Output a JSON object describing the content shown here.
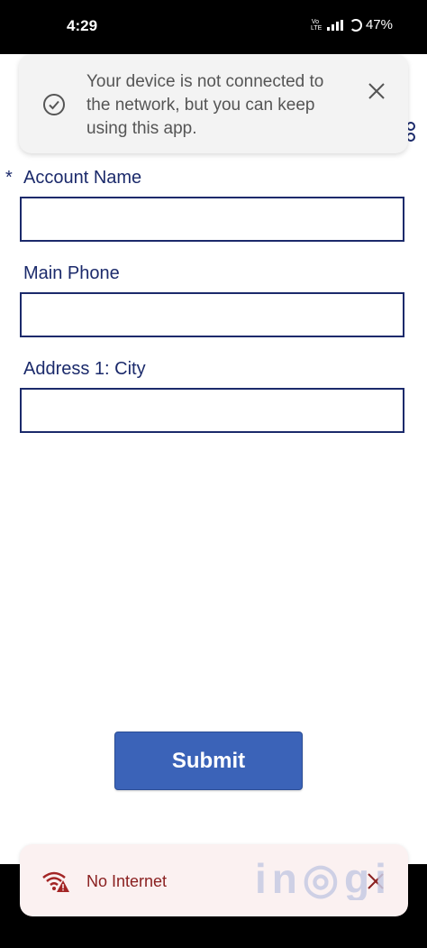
{
  "status_bar": {
    "time": "4:29",
    "network_label": "Vo LTE",
    "battery": "47%"
  },
  "toast": {
    "message": "Your device is not connected to the network, but you can keep using this app.",
    "icon": "check-circle-icon",
    "close_icon": "close-icon"
  },
  "form": {
    "required_marker": "*",
    "fields": [
      {
        "label": "Account Name",
        "value": "",
        "required": true
      },
      {
        "label": "Main Phone",
        "value": "",
        "required": false
      },
      {
        "label": "Address 1: City",
        "value": "",
        "required": false
      }
    ],
    "submit_label": "Submit"
  },
  "offline_banner": {
    "text": "No Internet",
    "icon": "wifi-warning-icon",
    "close_icon": "close-icon"
  },
  "watermark": "inogic",
  "colors": {
    "accent": "#3b63b8",
    "label": "#1b2a6b",
    "banner_text": "#8a2020",
    "banner_bg": "#fbf1f1"
  }
}
